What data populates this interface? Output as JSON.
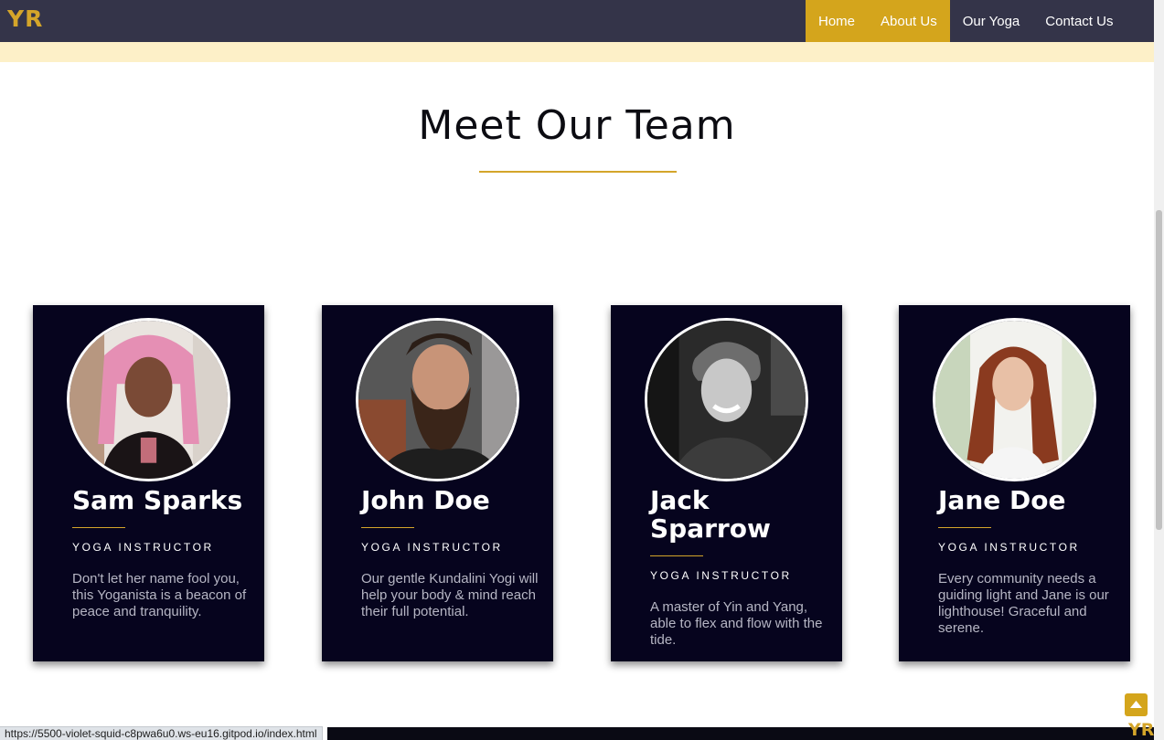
{
  "nav": {
    "logo": "YR",
    "links": [
      {
        "label": "Home",
        "active": true
      },
      {
        "label": "About Us",
        "active": true
      },
      {
        "label": "Our Yoga",
        "active": false
      },
      {
        "label": "Contact Us",
        "active": false
      }
    ]
  },
  "section": {
    "title": "Meet Our Team"
  },
  "team": [
    {
      "name": "Sam Sparks",
      "role": "YOGA INSTRUCTOR",
      "description": "Don't let her name fool you, this Yoganista is a beacon of peace and tranquility."
    },
    {
      "name": "John Doe",
      "role": "YOGA INSTRUCTOR",
      "description": "Our gentle Kundalini Yogi will help your body & mind reach their full potential."
    },
    {
      "name": "Jack Sparrow",
      "role": "YOGA INSTRUCTOR",
      "description": "A master of Yin and Yang, able to flex and flow with the tide."
    },
    {
      "name": "Jane Doe",
      "role": "YOGA INSTRUCTOR",
      "description": "Every community needs a guiding light and Jane is our lighthouse! Graceful and serene."
    }
  ],
  "status_bar": {
    "url": "https://5500-violet-squid-c8pwa6u0.ws-eu16.gitpod.io/index.html"
  },
  "footer": {
    "logo": "YR",
    "scroll_top_icon": "chevron-up-icon"
  },
  "colors": {
    "nav_bg": "#343449",
    "accent": "#d4a52a",
    "card_bg": "#06041e",
    "banner": "#fdf0c8"
  }
}
